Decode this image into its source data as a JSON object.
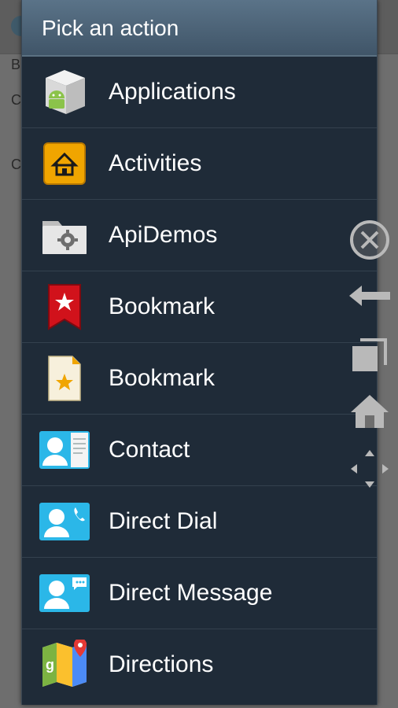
{
  "background": {
    "text_lines": [
      "B",
      "C",
      "C"
    ]
  },
  "dialog": {
    "title": "Pick an action",
    "items": [
      {
        "label": "Applications",
        "icon": "applications-icon"
      },
      {
        "label": "Activities",
        "icon": "activities-icon"
      },
      {
        "label": "ApiDemos",
        "icon": "apidemos-folder-icon"
      },
      {
        "label": "Bookmark",
        "icon": "bookmark-ribbon-icon"
      },
      {
        "label": "Bookmark",
        "icon": "bookmark-page-icon"
      },
      {
        "label": "Contact",
        "icon": "contact-card-icon"
      },
      {
        "label": "Direct Dial",
        "icon": "direct-dial-icon"
      },
      {
        "label": "Direct Message",
        "icon": "direct-message-icon"
      },
      {
        "label": "Directions",
        "icon": "maps-icon"
      }
    ]
  },
  "side_controls": [
    "close-icon",
    "back-arrow-icon",
    "recent-apps-icon",
    "home-icon",
    "move-icon"
  ],
  "colors": {
    "dialog_bg": "#1f2b38",
    "title_bar": "#4d6578",
    "accent_cyan": "#2bb7e8",
    "accent_orange": "#f0a500",
    "accent_red": "#d1121b"
  }
}
